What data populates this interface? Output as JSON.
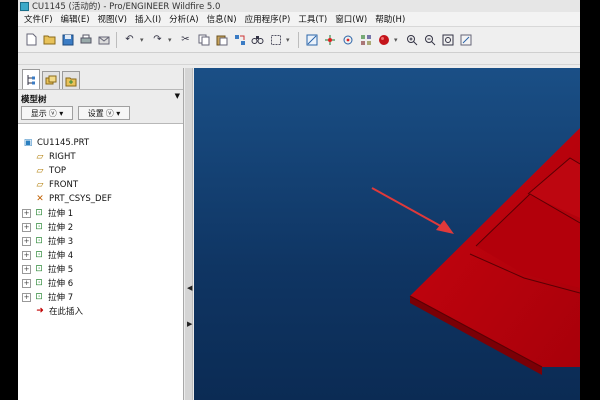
{
  "window": {
    "title": "CU1145 (活动的) - Pro/ENGINEER Wildfire 5.0"
  },
  "menu": [
    {
      "label": "文件(F)"
    },
    {
      "label": "编辑(E)"
    },
    {
      "label": "视图(V)"
    },
    {
      "label": "插入(I)"
    },
    {
      "label": "分析(A)"
    },
    {
      "label": "信息(N)"
    },
    {
      "label": "应用程序(P)"
    },
    {
      "label": "工具(T)"
    },
    {
      "label": "窗口(W)"
    },
    {
      "label": "帮助(H)"
    }
  ],
  "toolbar": {
    "icons": [
      "new-file-icon",
      "open-file-icon",
      "save-icon",
      "print-icon",
      "send-icon",
      "undo-icon",
      "redo-icon",
      "cut-icon",
      "copy-icon",
      "paste-icon",
      "regenerate-icon",
      "find-icon",
      "select-box-icon",
      "repaint-icon",
      "orient-icon",
      "spin-center-icon",
      "appearance-icon",
      "zoom-in-icon",
      "zoom-out-icon",
      "refit-icon",
      "view-manager-icon"
    ]
  },
  "panel": {
    "tabs": [
      "model-tree-tab",
      "layer-tab",
      "favorites-tab"
    ],
    "tree_title": "模型树",
    "show_label": "显示",
    "settings_label": "设置"
  },
  "tree": {
    "root": "CU1145.PRT",
    "datums": [
      "RIGHT",
      "TOP",
      "FRONT"
    ],
    "csys": "PRT_CSYS_DEF",
    "extrudes": [
      "拉伸 1",
      "拉伸 2",
      "拉伸 3",
      "拉伸 4",
      "拉伸 5",
      "拉伸 6",
      "拉伸 7"
    ],
    "insert_here": "在此插入"
  },
  "colors": {
    "viewport_top": "#1a4f86",
    "viewport_bottom": "#0b2b54",
    "part_red": "#b0000a",
    "arrow_red": "#e0393a"
  }
}
